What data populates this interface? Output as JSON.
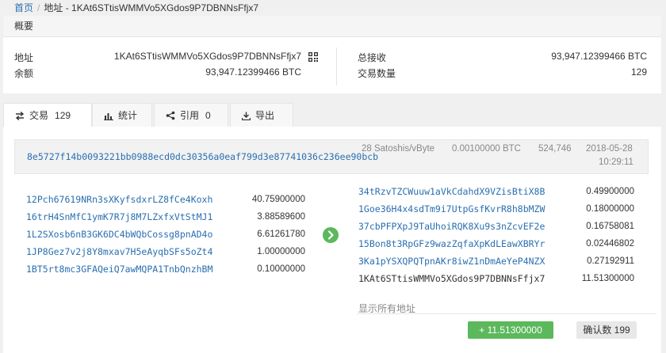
{
  "breadcrumb": {
    "home": "首页",
    "current": "地址 - 1KAt6STtisWMMVo5XGdos9P7DBNNsFfjx7"
  },
  "summary": {
    "title": "概要",
    "address_label": "地址",
    "address_value": "1KAt6STtisWMMVo5XGdos9P7DBNNsFfjx7",
    "balance_label": "余额",
    "balance_value": "93,947.12399466 BTC",
    "total_received_label": "总接收",
    "total_received_value": "93,947.12399466 BTC",
    "tx_count_label": "交易数量",
    "tx_count_value": "129"
  },
  "tabs": [
    {
      "label": "交易",
      "count": "129",
      "icon": "exchange-icon"
    },
    {
      "label": "统计",
      "icon": "bar-chart-icon"
    },
    {
      "label": "引用",
      "count": "0",
      "icon": "share-icon"
    },
    {
      "label": "导出",
      "icon": "download-icon"
    }
  ],
  "transaction": {
    "hash": "8e5727f14b0093221bb0988ecd0dc30356a0eaf799d3e87741036c236ee90bcb",
    "fee_rate": "28 Satoshis/vByte",
    "fee": "0.00100000 BTC",
    "block": "524,746",
    "date": "2018-05-28",
    "time": "10:29:11",
    "inputs": [
      {
        "address": "12Pch67619NRn3sXKyfsdxrLZ8fCe4Koxh",
        "amount": "40.75900000"
      },
      {
        "address": "16trH4SnMfC1ymK7R7j8M7LZxfxVtStMJ1",
        "amount": "3.88589600"
      },
      {
        "address": "1L2SXosb6nB3GK6DC4bWQbCossg8pnAD4o",
        "amount": "6.61261780"
      },
      {
        "address": "1JP8Gez7v2j8Y8mxav7H5eAyqbSFs5oZt4",
        "amount": "1.00000000"
      },
      {
        "address": "1BT5rt8mc3GFAQeiQ7awMQPA1TnbQnzhBM",
        "amount": "0.10000000"
      }
    ],
    "outputs": [
      {
        "address": "34tRzvTZCWuuw1aVkCdahdX9VZisBtiX8B",
        "amount": "0.49900000"
      },
      {
        "address": "1Goe36H4x4sdTm9i7UtpGsfKvrR8h8bMZW",
        "amount": "0.18000000"
      },
      {
        "address": "37cbPFPXpJ9TaUhoiRQK8Xu9s3nZcvEF2e",
        "amount": "0.16758081"
      },
      {
        "address": "15Bon8t3RpGFz9wazZqfaXpKdLEawXBRYr",
        "amount": "0.02446802"
      },
      {
        "address": "3Ka1pYSXQPQTpnAKr8iwZ1nDmAeYeP4NZX",
        "amount": "0.27192911"
      },
      {
        "address": "1KAt6STtisWMMVo5XGdos9P7DBNNsFfjx7",
        "amount": "11.51300000"
      }
    ],
    "show_all": "显示所有地址",
    "net_amount": "+ 11.51300000",
    "confirmations": "确认数 199"
  },
  "colors": {
    "link": "#2a6fb0",
    "success": "#5cb85c"
  }
}
